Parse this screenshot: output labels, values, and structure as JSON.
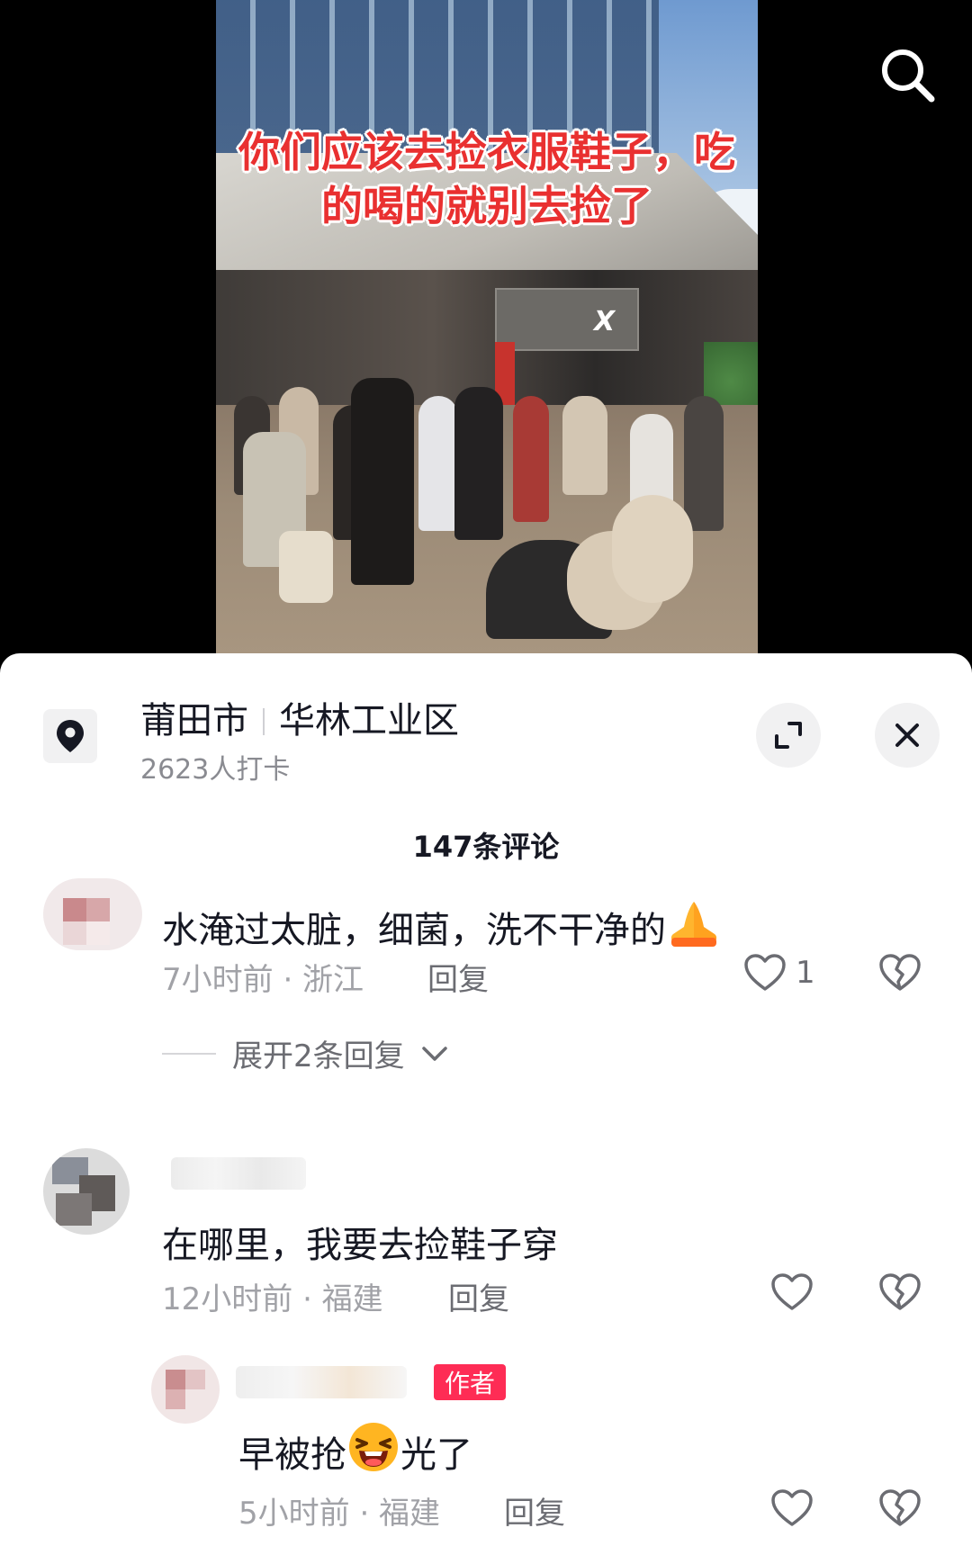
{
  "video": {
    "caption": "你们应该去捡衣服鞋子，吃的喝的就别去捡了",
    "sign_text": "X",
    "search_icon": "search-icon"
  },
  "location": {
    "city": "莆田市",
    "area": "华林工业区",
    "checkins": "2623人打卡",
    "pin_icon": "location-pin-icon",
    "expand_icon": "expand-icon",
    "close_icon": "close-icon"
  },
  "comment_count": "147条评论",
  "comments": [
    {
      "text": "水淹过太脏，细菌，洗不干净的",
      "emoji": "pray-emoji",
      "time_region": "7小时前 · 浙江",
      "reply_label": "回复",
      "like_count": "1",
      "expand_label": "展开2条回复"
    },
    {
      "text": "在哪里，我要去捡鞋子穿",
      "time_region": "12小时前 · 福建",
      "reply_label": "回复",
      "like_count": ""
    }
  ],
  "reply": {
    "author_tag": "作者",
    "text_before": "早被抢",
    "emoji": "laughing-emoji",
    "text_after": "光了",
    "time_region": "5小时前 · 福建",
    "reply_label": "回复"
  },
  "colors": {
    "accent": "#fe2c55",
    "text_primary": "#161823",
    "text_secondary": "#a1a2a7"
  }
}
